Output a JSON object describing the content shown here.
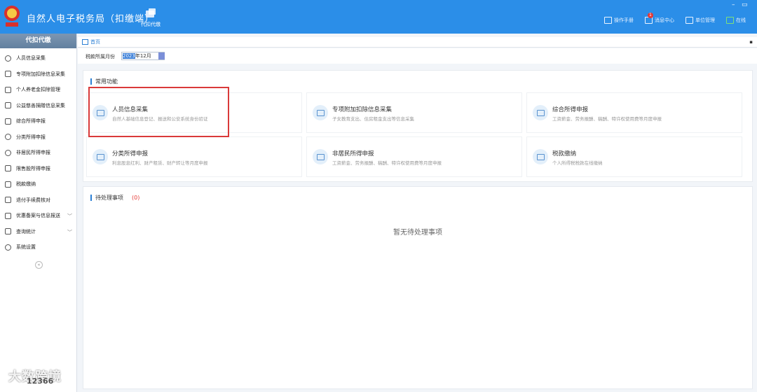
{
  "header": {
    "title": "自然人电子税务局（扣缴端）",
    "nav_button": "代扣代缴",
    "tools": [
      {
        "label": "操作手册",
        "icon": "manual-icon"
      },
      {
        "label": "消息中心",
        "icon": "message-icon",
        "badge": "1"
      },
      {
        "label": "单位管理",
        "icon": "building-icon"
      },
      {
        "label": "在线",
        "icon": "online-icon"
      }
    ],
    "window_controls": [
      "–",
      "▭"
    ]
  },
  "sidebar": {
    "title": "代扣代缴",
    "items": [
      {
        "label": "人员信息采集",
        "icon": "person-icon"
      },
      {
        "label": "专项附加扣除信息采集",
        "icon": "grid-icon"
      },
      {
        "label": "个人养老金扣除管理",
        "icon": "wallet-icon"
      },
      {
        "label": "公益慈善捐赠信息采集",
        "icon": "donation-icon"
      },
      {
        "label": "综合所得申报",
        "icon": "report-icon"
      },
      {
        "label": "分类所得申报",
        "icon": "pie-icon"
      },
      {
        "label": "非居民所得申报",
        "icon": "nonresident-icon"
      },
      {
        "label": "限售股所得申报",
        "icon": "bar-chart-icon"
      },
      {
        "label": "税款缴纳",
        "icon": "payment-icon"
      },
      {
        "label": "退付手续费核对",
        "icon": "refund-icon"
      },
      {
        "label": "优惠备案与信息报送",
        "icon": "file-icon",
        "expandable": true
      },
      {
        "label": "查询统计",
        "icon": "query-icon",
        "expandable": true
      },
      {
        "label": "系统设置",
        "icon": "gear-icon"
      }
    ],
    "collapse": "«"
  },
  "tab": {
    "label": "首页",
    "close": "▪"
  },
  "period": {
    "label": "税款所属月份",
    "value_selected": "2023",
    "value_rest": "年12月"
  },
  "common": {
    "title": "常用功能",
    "cards": [
      {
        "title": "人员信息采集",
        "desc": "自然人基础信息登记、报送和公安系统身份验证"
      },
      {
        "title": "专项附加扣除信息采集",
        "desc": "子女教育支出、住房租金支出等信息采集"
      },
      {
        "title": "综合所得申报",
        "desc": "工资薪金、劳务报酬、稿酬、特许权使用费等月度申报"
      },
      {
        "title": "分类所得申报",
        "desc": "利息股息红利、财产租赁、财产转让等月度申报"
      },
      {
        "title": "非居民所得申报",
        "desc": "工资薪金、劳务报酬、稿酬、特许权使用费等月度申报"
      },
      {
        "title": "税款缴纳",
        "desc": "个人所得税税款在线缴纳"
      }
    ]
  },
  "pending": {
    "title": "待处理事项",
    "count": "(0)",
    "empty": "暂无待处理事项"
  },
  "watermark": {
    "text": "大数跨境",
    "sub": "12366"
  },
  "colors": {
    "header": "#2b8ee8",
    "accent": "#2b7fd4",
    "highlight_box": "#d93a3a",
    "count": "#e53935"
  }
}
